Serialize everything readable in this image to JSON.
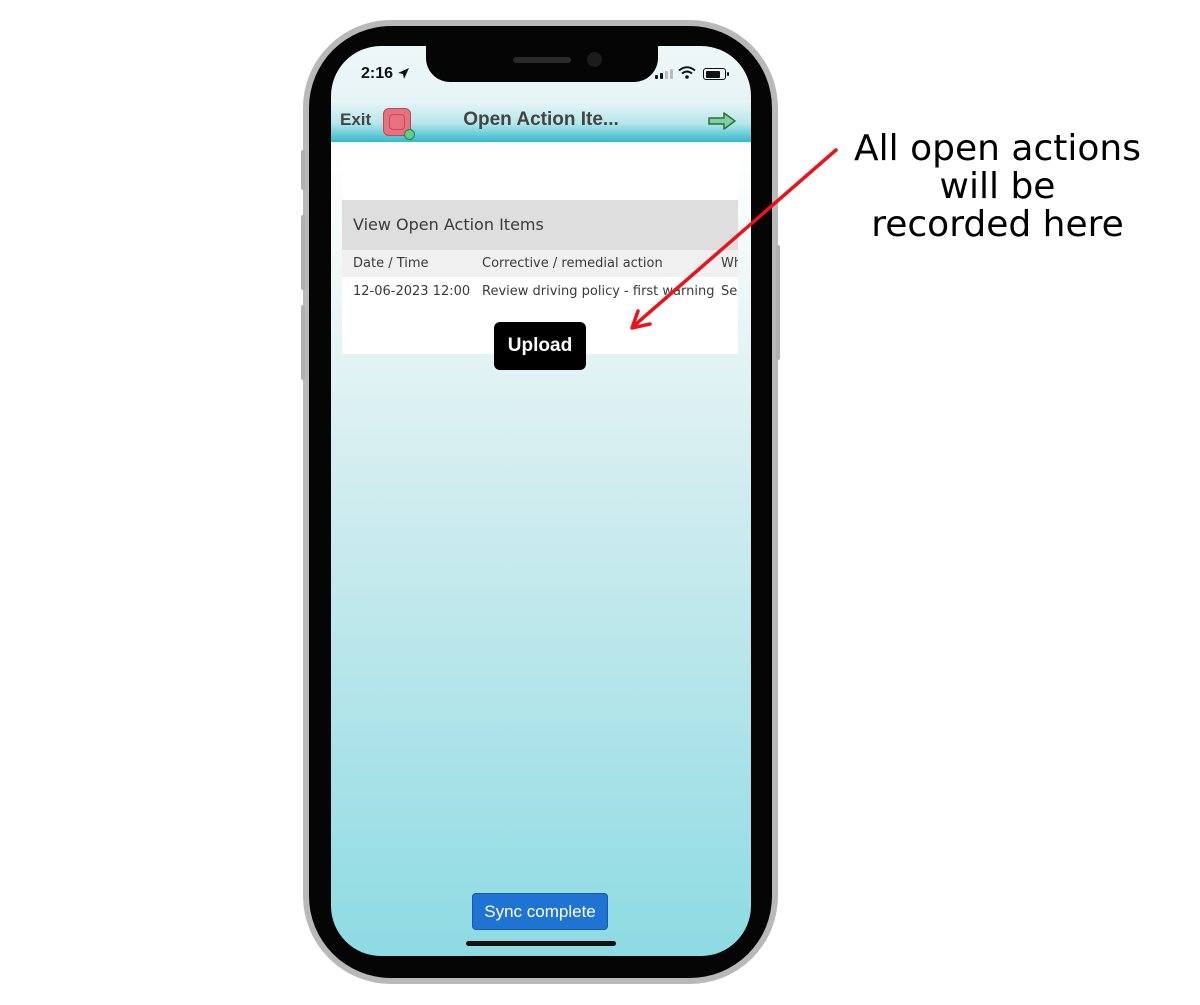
{
  "status_bar": {
    "time": "2:16"
  },
  "header": {
    "exit_label": "Exit",
    "title": "Open Action Ite..."
  },
  "section": {
    "title": "View Open Action Items"
  },
  "table": {
    "columns": [
      "Date / Time",
      "Corrective / remedial action",
      "Wh"
    ],
    "rows": [
      [
        "12-06-2023 12:00",
        "Review driving policy - first warning",
        "Se"
      ]
    ]
  },
  "buttons": {
    "upload_label": "Upload",
    "sync_label": "Sync complete"
  },
  "annotation": {
    "lines": [
      "All open actions",
      "will be",
      "recorded here"
    ]
  },
  "colors": {
    "sync_button": "#1f73d2",
    "upload_button": "#000000",
    "annotation_arrow": "#e8141c",
    "header_accent": "#35b9c9"
  }
}
